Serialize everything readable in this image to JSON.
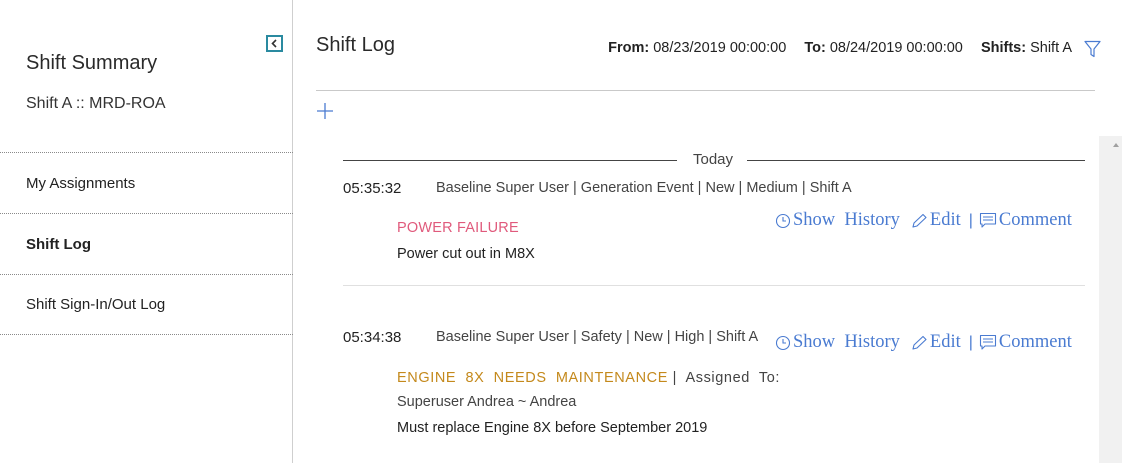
{
  "sidebar": {
    "title": "Shift Summary",
    "subtitle": "Shift A :: MRD-ROA",
    "collapse_icon": "chevron-left-icon",
    "items": [
      {
        "label": "My Assignments",
        "active": false
      },
      {
        "label": "Shift Log",
        "active": true
      },
      {
        "label": "Shift Sign-In/Out Log",
        "active": false
      }
    ]
  },
  "header": {
    "title": "Shift Log",
    "from_label": "From:",
    "from_value": "08/23/2019 00:00:00",
    "to_label": "To:",
    "to_value": "08/24/2019 00:00:00",
    "shifts_label": "Shifts:",
    "shifts_value": "Shift A",
    "filter_icon": "filter-icon",
    "add_icon": "plus-icon"
  },
  "timeline": {
    "day_label": "Today",
    "actions": {
      "show_history": "Show  History",
      "edit": "Edit",
      "separator": "|",
      "comment": "Comment"
    },
    "entries": [
      {
        "time": "05:35:32",
        "meta": "Baseline Super User | Generation Event | New | Medium | Shift A",
        "title": "POWER FAILURE",
        "description": "Power cut out in M8X"
      },
      {
        "time": "05:34:38",
        "meta": "Baseline Super User | Safety | New | High | Shift A",
        "title": "ENGINE  8X  NEEDS  MAINTENANCE",
        "assigned_prefix": "|  Assigned  To:",
        "assignee": "Superuser Andrea ~ Andrea",
        "description": "Must replace Engine 8X before September 2019"
      }
    ]
  },
  "colors": {
    "accent": "#4a7bd1",
    "collapse_border": "#2a8aa0",
    "title_red": "#e05a7c",
    "title_gold": "#c4891c"
  }
}
